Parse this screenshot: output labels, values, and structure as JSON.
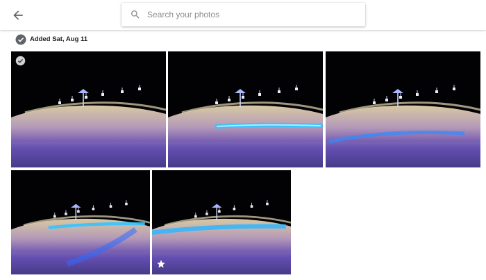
{
  "header": {
    "back_icon": "arrow-left-icon",
    "search": {
      "icon": "search-icon",
      "placeholder": "Search your photos",
      "value": ""
    }
  },
  "section": {
    "title": "Added Sat, Aug 11",
    "select_icon": "check-circle-icon"
  },
  "photos": [
    {
      "label": "photo-1",
      "overlay_icon": "check-circle-icon",
      "streak": "none"
    },
    {
      "label": "photo-2",
      "overlay_icon": "",
      "streak": "straight"
    },
    {
      "label": "photo-3",
      "overlay_icon": "",
      "streak": "faint"
    },
    {
      "label": "photo-4",
      "overlay_icon": "",
      "streak": "curve"
    },
    {
      "label": "photo-5",
      "overlay_icon": "star-icon",
      "streak": "wide"
    }
  ],
  "colors": {
    "accent_grey": "#5f6368",
    "title_text": "#212121",
    "streak": "#33c4ff",
    "ground_purple": "#5a3fb0"
  }
}
